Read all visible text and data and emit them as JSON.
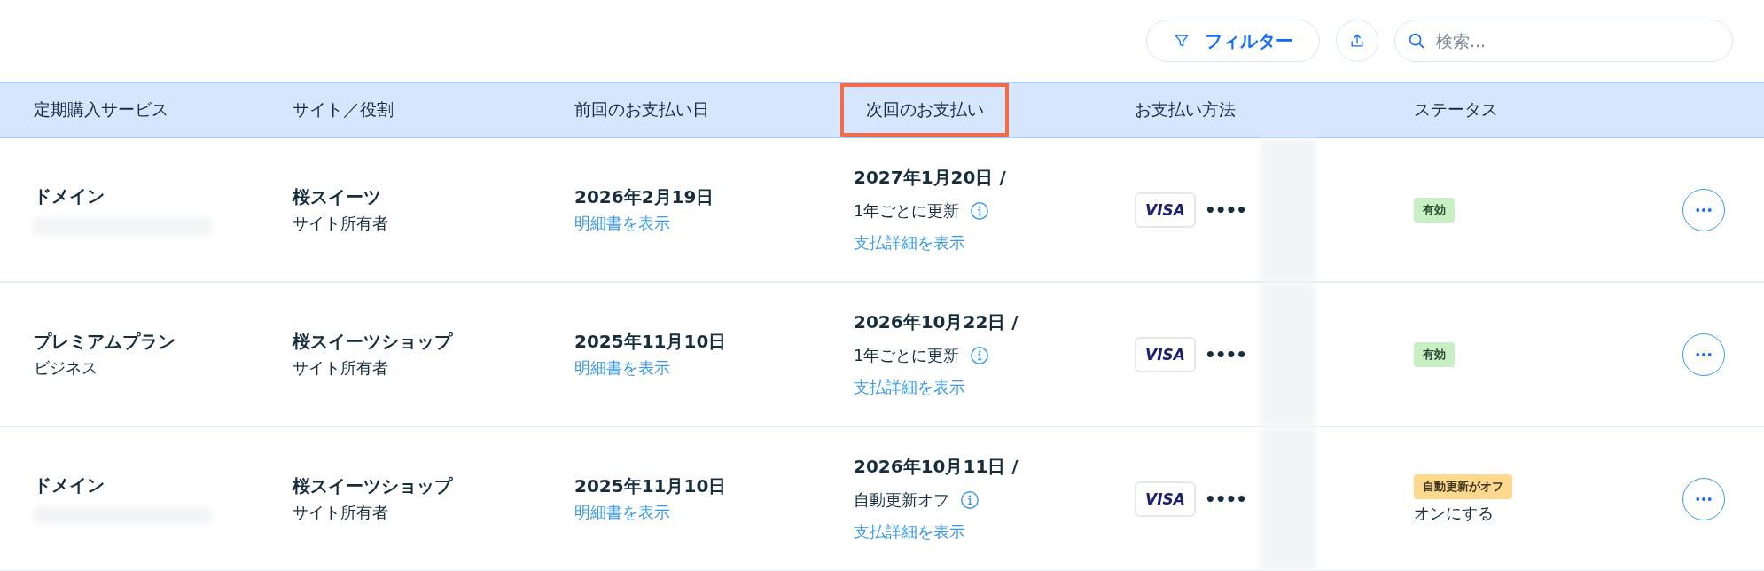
{
  "toolbar": {
    "filter_button": "フィルター",
    "search": {
      "placeholder": "検索..."
    }
  },
  "table": {
    "columns": [
      {
        "label": "定期購入サービス",
        "highlighted": false
      },
      {
        "label": "サイト／役割",
        "highlighted": false
      },
      {
        "label": "前回のお支払い日",
        "highlighted": false
      },
      {
        "label": "次回のお支払い",
        "highlighted": true
      },
      {
        "label": "お支払い方法",
        "highlighted": false
      },
      {
        "label": "ステータス",
        "highlighted": false
      }
    ],
    "rows": [
      {
        "service": "ドメイン",
        "service_detail_redacted": true,
        "site": "桜スイーツ",
        "role": "サイト所有者",
        "last_payment": "2026年2月19日",
        "invoice_link": "明細書を表示",
        "next_payment": "2027年1月20日 /",
        "renewal": "1年ごとに更新",
        "details_link": "支払詳細を表示",
        "card_brand": "VISA",
        "card_mask": "••••",
        "card_number_redacted": true,
        "status": {
          "kind": "active",
          "label": "有効"
        }
      },
      {
        "service": "プレミアムプラン",
        "service_detail": "ビジネス",
        "site": "桜スイーツショップ",
        "role": "サイト所有者",
        "last_payment": "2025年11月10日",
        "invoice_link": "明細書を表示",
        "next_payment": "2026年10月22日 /",
        "renewal": "1年ごとに更新",
        "details_link": "支払詳細を表示",
        "card_brand": "VISA",
        "card_mask": "••••",
        "card_number_redacted": true,
        "status": {
          "kind": "active",
          "label": "有効"
        }
      },
      {
        "service": "ドメイン",
        "service_detail_redacted": true,
        "site": "桜スイーツショップ",
        "role": "サイト所有者",
        "last_payment": "2025年11月10日",
        "invoice_link": "明細書を表示",
        "next_payment": "2026年10月11日 /",
        "renewal": "自動更新オフ",
        "details_link": "支払詳細を表示",
        "card_brand": "VISA",
        "card_mask": "••••",
        "card_number_redacted": true,
        "status": {
          "kind": "auto_renew_off",
          "label": "自動更新がオフ",
          "action": "オンにする"
        }
      }
    ]
  }
}
